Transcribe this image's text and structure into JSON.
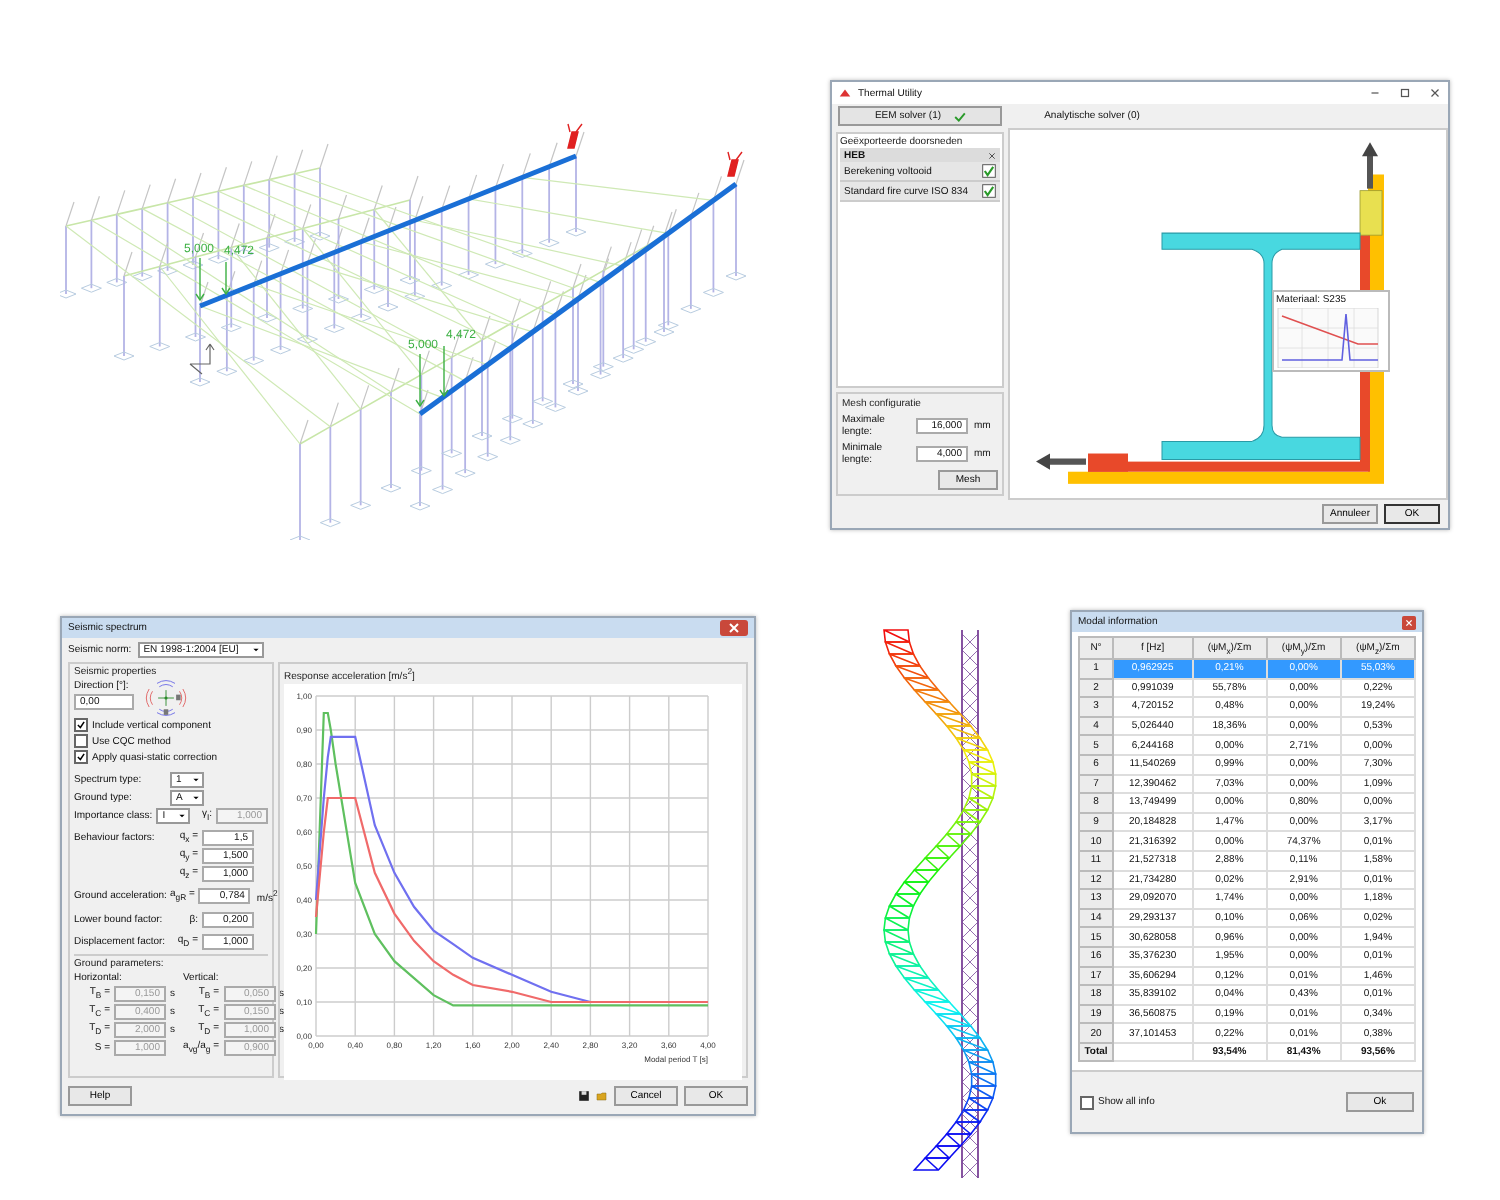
{
  "structure_view": {
    "load_labels": [
      "5,000",
      "4,472",
      "5,000",
      "4,472"
    ]
  },
  "thermal_utility": {
    "title": "Thermal Utility",
    "tabs": [
      {
        "label": "EEM solver (1)",
        "selected": true,
        "completed": true
      },
      {
        "label": "Analytische solver (0)",
        "selected": false,
        "completed": false
      }
    ],
    "sections_group": "Geëxporteerde doorsneden",
    "section_header": "HEB",
    "items": [
      {
        "label": "Berekening voltooid",
        "checked": true
      },
      {
        "label": "Standard fire curve ISO 834",
        "checked": true
      }
    ],
    "mesh": {
      "title": "Mesh configuratie",
      "fields": [
        {
          "label": "Maximale lengte:",
          "value": "16,000",
          "unit": "mm"
        },
        {
          "label": "Minimale lengte:",
          "value": "4,000",
          "unit": "mm"
        }
      ],
      "button": "Mesh"
    },
    "tooltip_title": "Materiaal: S235",
    "buttons": [
      "Annuleer",
      "OK"
    ]
  },
  "seismic_spectrum": {
    "title": "Seismic spectrum",
    "norm_label": "Seismic norm:",
    "norm_value": "EN 1998-1:2004 [EU]",
    "properties_title": "Seismic properties",
    "direction_label": "Direction [°]:",
    "direction_value": "0,00",
    "checkboxes": [
      {
        "label": "Include vertical component",
        "checked": true
      },
      {
        "label": "Use CQC method",
        "checked": false
      },
      {
        "label": "Apply quasi-static correction",
        "checked": true
      }
    ],
    "selects": [
      {
        "label": "Spectrum type:",
        "value": "1"
      },
      {
        "label": "Ground type:",
        "value": "A"
      },
      {
        "label": "Importance class:",
        "value": "I",
        "factor": {
          "symbol": "γ$_{I}$:",
          "value": "1,000",
          "disabled": true
        }
      }
    ],
    "parameters": [
      {
        "label": "Behaviour factors:",
        "symbol": "q$_{x}$ =",
        "value": "1,5"
      },
      {
        "symbol": "q$_{y}$ =",
        "value": "1,500"
      },
      {
        "symbol": "q$_{z}$ =",
        "value": "1,000"
      },
      {
        "label": "Ground acceleration:",
        "symbol": "a$_{gR}$ =",
        "value": "0,784",
        "unit": "m/s$^{2}$"
      },
      {
        "label": "Lower bound factor:",
        "symbol": "β:",
        "value": "0,200"
      },
      {
        "label": "Displacement factor:",
        "symbol": "q$_{D}$ =",
        "value": "1,000"
      }
    ],
    "ground": {
      "title": "Ground parameters:",
      "horizontal": {
        "title": "Horizontal:",
        "disabled": true,
        "rows": [
          {
            "symbol": "T$_{B}$ =",
            "value": "0,150",
            "unit": "s"
          },
          {
            "symbol": "T$_{C}$ =",
            "value": "0,400",
            "unit": "s"
          },
          {
            "symbol": "T$_{D}$ =",
            "value": "2,000",
            "unit": "s"
          },
          {
            "symbol": "S =",
            "value": "1,000"
          }
        ]
      },
      "vertical": {
        "title": "Vertical:",
        "disabled": true,
        "rows": [
          {
            "symbol": "T$_{B}$ =",
            "value": "0,050",
            "unit": "s"
          },
          {
            "symbol": "T$_{C}$ =",
            "value": "0,150",
            "unit": "s"
          },
          {
            "symbol": "T$_{D}$ =",
            "value": "1,000",
            "unit": "s"
          },
          {
            "symbol": "a$_{vg}$/a$_{g}$ =",
            "value": "0,900"
          }
        ]
      }
    },
    "chart": {
      "chart_data": {
        "type": "line",
        "title": "Response acceleration [m/s$^{2}$]",
        "xlabel": "Modal period T [s]",
        "x": [
          0,
          0.08,
          0.12,
          0.15,
          0.2,
          0.4,
          0.6,
          0.8,
          1.0,
          1.2,
          1.4,
          1.6,
          2.0,
          2.4,
          2.8,
          3.2,
          3.6,
          4.0
        ],
        "series": [
          {
            "color": "#5fc05f",
            "values": [
              0.3,
              0.95,
              0.95,
              0.9,
              0.8,
              0.45,
              0.3,
              0.22,
              0.17,
              0.12,
              0.09,
              0.09,
              0.09,
              0.09,
              0.09,
              0.09,
              0.09,
              0.09
            ]
          },
          {
            "color": "#7070f0",
            "values": [
              0.4,
              0.7,
              0.82,
              0.88,
              0.88,
              0.88,
              0.62,
              0.48,
              0.38,
              0.31,
              0.27,
              0.23,
              0.18,
              0.13,
              0.1,
              null,
              null,
              null
            ]
          },
          {
            "color": "#f06a6a",
            "values": [
              0.35,
              0.6,
              0.7,
              0.7,
              0.7,
              0.7,
              0.48,
              0.36,
              0.28,
              0.22,
              0.18,
              0.15,
              0.13,
              0.1,
              0.1,
              0.1,
              0.1,
              0.1
            ]
          }
        ],
        "xlim": [
          0,
          4
        ],
        "ylim": [
          0,
          1
        ],
        "grid": true,
        "xticks": [
          {
            "value": 0,
            "label": "0,00"
          },
          {
            "value": 0.4,
            "label": "0,40"
          },
          {
            "value": 0.8,
            "label": "0,80"
          },
          {
            "value": 1.2,
            "label": "1,20"
          },
          {
            "value": 1.6,
            "label": "1,60"
          },
          {
            "value": 2.0,
            "label": "2,00"
          },
          {
            "value": 2.4,
            "label": "2,40"
          },
          {
            "value": 2.8,
            "label": "2,80"
          },
          {
            "value": 3.2,
            "label": "3,20"
          },
          {
            "value": 3.6,
            "label": "3,60"
          },
          {
            "value": 4.0,
            "label": "4,00"
          }
        ],
        "yticks": [
          {
            "value": 0,
            "label": "0,00"
          },
          {
            "value": 0.1,
            "label": "0,10"
          },
          {
            "value": 0.2,
            "label": "0,20"
          },
          {
            "value": 0.3,
            "label": "0,30"
          },
          {
            "value": 0.4,
            "label": "0,40"
          },
          {
            "value": 0.5,
            "label": "0,50"
          },
          {
            "value": 0.6,
            "label": "0,60"
          },
          {
            "value": 0.7,
            "label": "0,70"
          },
          {
            "value": 0.8,
            "label": "0,80"
          },
          {
            "value": 0.9,
            "label": "0,90"
          },
          {
            "value": 1.0,
            "label": "1,00"
          }
        ]
      }
    },
    "buttons": {
      "help": "Help",
      "cancel": "Cancel",
      "ok": "OK"
    }
  },
  "modal_information": {
    "title": "Modal information",
    "columns": [
      "N°",
      "f [Hz]",
      "(ψM$_{x}$)/Σm",
      "(ψM$_{y}$)/Σm",
      "(ψM$_{z}$)/Σm"
    ],
    "rows": [
      {
        "selected": true,
        "cells": [
          "1",
          "0,962925",
          "0,21%",
          "0,00%",
          "55,03%"
        ]
      },
      {
        "selected": false,
        "cells": [
          "2",
          "0,991039",
          "55,78%",
          "0,00%",
          "0,22%"
        ]
      },
      {
        "selected": false,
        "cells": [
          "3",
          "4,720152",
          "0,48%",
          "0,00%",
          "19,24%"
        ]
      },
      {
        "selected": false,
        "cells": [
          "4",
          "5,026440",
          "18,36%",
          "0,00%",
          "0,53%"
        ]
      },
      {
        "selected": false,
        "cells": [
          "5",
          "6,244168",
          "0,00%",
          "2,71%",
          "0,00%"
        ]
      },
      {
        "selected": false,
        "cells": [
          "6",
          "11,540269",
          "0,99%",
          "0,00%",
          "7,30%"
        ]
      },
      {
        "selected": false,
        "cells": [
          "7",
          "12,390462",
          "7,03%",
          "0,00%",
          "1,09%"
        ]
      },
      {
        "selected": false,
        "cells": [
          "8",
          "13,749499",
          "0,00%",
          "0,80%",
          "0,00%"
        ]
      },
      {
        "selected": false,
        "cells": [
          "9",
          "20,184828",
          "1,47%",
          "0,00%",
          "3,17%"
        ]
      },
      {
        "selected": false,
        "cells": [
          "10",
          "21,316392",
          "0,00%",
          "74,37%",
          "0,01%"
        ]
      },
      {
        "selected": false,
        "cells": [
          "11",
          "21,527318",
          "2,88%",
          "0,11%",
          "1,58%"
        ]
      },
      {
        "selected": false,
        "cells": [
          "12",
          "21,734280",
          "0,02%",
          "2,91%",
          "0,01%"
        ]
      },
      {
        "selected": false,
        "cells": [
          "13",
          "29,092070",
          "1,74%",
          "0,00%",
          "1,18%"
        ]
      },
      {
        "selected": false,
        "cells": [
          "14",
          "29,293137",
          "0,10%",
          "0,06%",
          "0,02%"
        ]
      },
      {
        "selected": false,
        "cells": [
          "15",
          "30,628058",
          "0,96%",
          "0,00%",
          "1,94%"
        ]
      },
      {
        "selected": false,
        "cells": [
          "16",
          "35,376230",
          "1,95%",
          "0,00%",
          "0,01%"
        ]
      },
      {
        "selected": false,
        "cells": [
          "17",
          "35,606294",
          "0,12%",
          "0,01%",
          "1,46%"
        ]
      },
      {
        "selected": false,
        "cells": [
          "18",
          "35,839102",
          "0,04%",
          "0,43%",
          "0,01%"
        ]
      },
      {
        "selected": false,
        "cells": [
          "19",
          "36,560875",
          "0,19%",
          "0,01%",
          "0,34%"
        ]
      },
      {
        "selected": false,
        "cells": [
          "20",
          "37,101453",
          "0,22%",
          "0,01%",
          "0,38%"
        ]
      }
    ],
    "total": {
      "label": "Total",
      "values": [
        "93,54%",
        "81,43%",
        "93,56%"
      ]
    },
    "show_all": {
      "label": "Show all info",
      "checked": false
    },
    "button": "Ok"
  }
}
